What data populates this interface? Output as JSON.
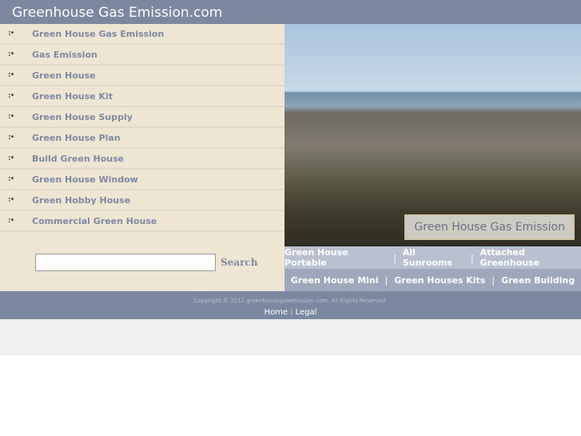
{
  "header": {
    "title": "Greenhouse Gas Emission.com"
  },
  "sidebar": {
    "items": [
      {
        "label": "Green House Gas Emission"
      },
      {
        "label": "Gas Emission"
      },
      {
        "label": "Green House"
      },
      {
        "label": "Green House Kit"
      },
      {
        "label": "Green House Supply"
      },
      {
        "label": "Green House Plan"
      },
      {
        "label": "Build Green House"
      },
      {
        "label": "Green House Window"
      },
      {
        "label": "Green Hobby House"
      },
      {
        "label": "Commercial Green House"
      }
    ]
  },
  "search": {
    "value": "",
    "button": "Search"
  },
  "photo": {
    "caption": "Green House Gas Emission"
  },
  "links_row1": [
    "Green House Portable",
    "All Sunrooms",
    "Attached Greenhouse"
  ],
  "links_row2": [
    "Green House Mini",
    "Green Houses Kits",
    "Green Building"
  ],
  "separator": "|",
  "footer": {
    "copyright": "Copyright © 2011 greenhousegasemission.com. All Rights Reserved.",
    "home": "Home",
    "legal": "Legal"
  }
}
